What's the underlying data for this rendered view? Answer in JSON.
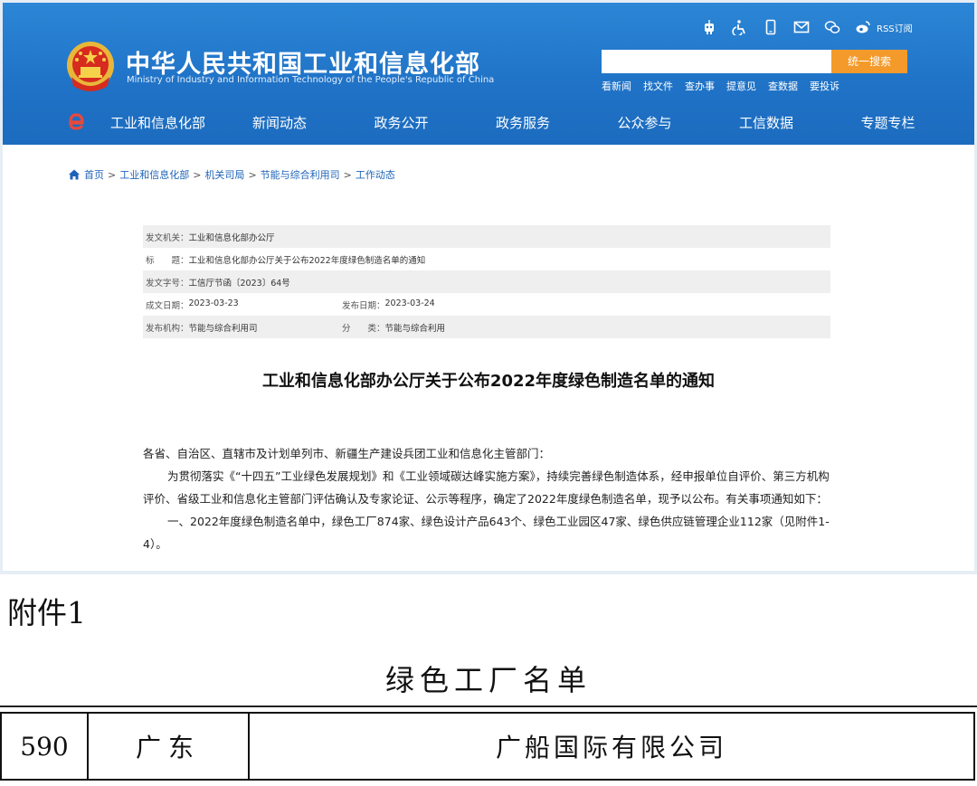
{
  "header": {
    "title": "中华人民共和国工业和信息化部",
    "subtitle": "Ministry of Industry and Information Technology of the People's Republic of China",
    "rss_label": "RSS订阅",
    "icons": [
      "robot-icon",
      "accessibility-icon",
      "mobile-icon",
      "mail-icon",
      "wechat-icon",
      "weibo-icon"
    ],
    "search": {
      "placeholder": "",
      "button_label": "统一搜索"
    },
    "quick_links": [
      "看新闻",
      "找文件",
      "查办事",
      "提意见",
      "查数据",
      "要投诉"
    ]
  },
  "nav": {
    "items": [
      "工业和信息化部",
      "新闻动态",
      "政务公开",
      "政务服务",
      "公众参与",
      "工信数据",
      "专题专栏"
    ]
  },
  "breadcrumb": [
    "首页",
    "工业和信息化部",
    "机关司局",
    "节能与综合利用司",
    "工作动态"
  ],
  "meta": {
    "issuer_label": "发文机关：",
    "issuer": "工业和信息化部办公厅",
    "title_label": "标　　题：",
    "title": "工业和信息化部办公厅关于公布2022年度绿色制造名单的通知",
    "doc_no_label": "发文字号：",
    "doc_no": "工信厅节函〔2023〕64号",
    "written_label": "成文日期：",
    "written": "2023-03-23",
    "published_label": "发布日期：",
    "published": "2023-03-24",
    "org_label": "发布机构：",
    "org": "节能与综合利用司",
    "category_label": "分　　类：",
    "category": "节能与综合利用"
  },
  "document": {
    "title": "工业和信息化部办公厅关于公布2022年度绿色制造名单的通知",
    "paragraphs": [
      "各省、自治区、直辖市及计划单列市、新疆生产建设兵团工业和信息化主管部门：",
      "为贯彻落实《“十四五”工业绿色发展规划》和《工业领域碳达峰实施方案》，持续完善绿色制造体系，经申报单位自评价、第三方机构评价、省级工业和信息化主管部门评估确认及专家论证、公示等程序，确定了2022年度绿色制造名单，现予以公布。有关事项通知如下：",
      "一、2022年度绿色制造名单中，绿色工厂874家、绿色设计产品643个、绿色工业园区47家、绿色供应链管理企业112家（见附件1-4）。"
    ]
  },
  "attachment": {
    "label": "附件1",
    "title": "绿色工厂名单",
    "row": {
      "number": "590",
      "province": "广东",
      "company": "广船国际有限公司"
    }
  },
  "colors": {
    "banner": "#1f72c6",
    "search_button": "#f39a2b",
    "link": "#1f63b8",
    "meta_shade": "#efefef"
  }
}
